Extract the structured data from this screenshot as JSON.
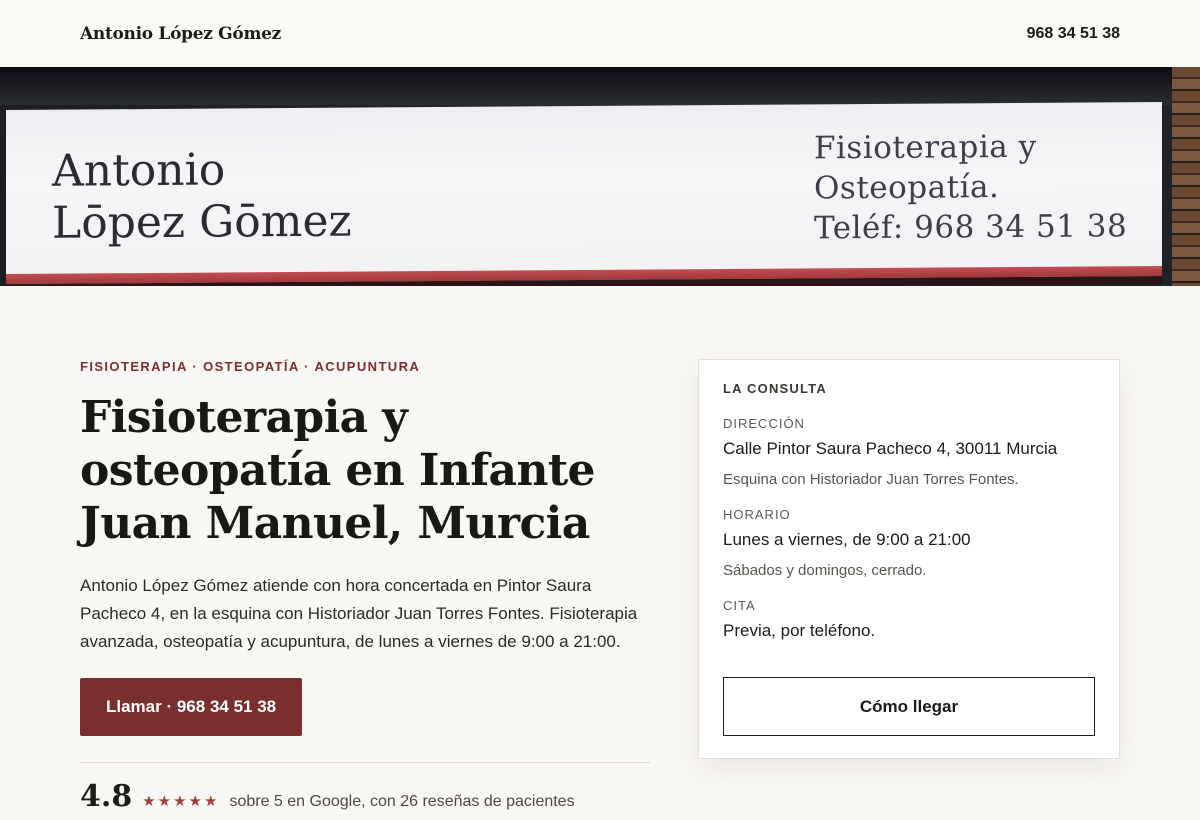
{
  "header": {
    "brand": "Antonio López Gómez",
    "phone": "968 34 51 38"
  },
  "hero": {
    "sign_name": "Antonio\nLōpez Gōmez",
    "sign_desc": "Fisioterapia y\nOsteopatía.\nTeléf: 968 34 51 38",
    "colors": {
      "sign_band": "#b5444a",
      "sign_panel": "#f2f2f5"
    }
  },
  "intro": {
    "eyebrow": "FISIOTERAPIA · OSTEOPATÍA · ACUPUNTURA",
    "title": "Fisioterapia y osteopatía en Infante Juan Manuel, Murcia",
    "lead": "Antonio López Gómez atiende con hora concertada en Pintor Saura Pacheco 4, en la esquina con Historiador Juan Torres Fontes. Fisioterapia avanzada, osteopatía y acupuntura, de lunes a viernes de 9:00 a 21:00.",
    "call_label": "Llamar · 968 34 51 38",
    "rating_value": "4.8",
    "rating_stars": "★★★★★",
    "rating_text": "sobre 5 en Google, con 26 reseñas de pacientes"
  },
  "card": {
    "title": "LA CONSULTA",
    "address_label": "DIRECCIÓN",
    "address_value": "Calle Pintor Saura Pacheco 4, 30011 Murcia",
    "address_note": "Esquina con Historiador Juan Torres Fontes.",
    "hours_label": "HORARIO",
    "hours_value": "Lunes a viernes, de 9:00 a 21:00",
    "hours_note": "Sábados y domingos, cerrado.",
    "appointment_label": "CITA",
    "appointment_value": "Previa, por teléfono.",
    "directions_label": "Cómo llegar"
  },
  "colors": {
    "accent": "#7a2f2f",
    "background": "#f9f7f3"
  }
}
